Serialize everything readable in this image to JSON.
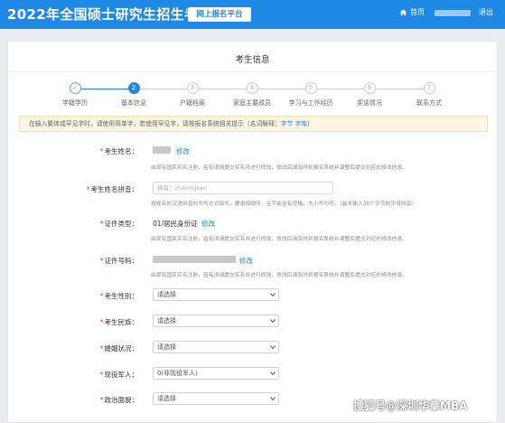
{
  "header": {
    "title": "2022年全国硕士研究生招生考试",
    "badge": "网上报名平台",
    "home_label": "首页",
    "logout_label": "退出",
    "bg_color": "#1e88e5"
  },
  "page_title": "考生信息",
  "steps": [
    {
      "num": "✓",
      "label": "学籍学历",
      "state": "done"
    },
    {
      "num": "2",
      "label": "基本信息",
      "state": "current"
    },
    {
      "num": "3",
      "label": "户籍档案",
      "state": "todo"
    },
    {
      "num": "4",
      "label": "家庭主要成员",
      "state": "todo"
    },
    {
      "num": "5",
      "label": "学习与工作经历",
      "state": "todo"
    },
    {
      "num": "6",
      "label": "奖惩情况",
      "state": "todo"
    },
    {
      "num": "7",
      "label": "联系方式",
      "state": "todo"
    }
  ],
  "notice": {
    "text": "在输入繁体或罕见字时，请使用简单字，若使用罕见字，请按报名系统相关提示（名词解释：",
    "link1": "字节",
    "link2": "字库",
    "end": "）"
  },
  "form": {
    "name": {
      "label": "考生姓名：",
      "edit": "修改",
      "help": "由现有国民实名注册，若有误请提交实名并进行修改，修改后请及时到报名系统并调整后提交对应的修改信息。"
    },
    "pinyin": {
      "label": "考生姓名拼音：",
      "placeholder": "拼音：zhanngsan",
      "help": "按姓名的汉语拼音的书写方式填写，要求按顺序，且不能含有空格，大小写均可。（最多输入30个字节的字母拼音）"
    },
    "id_type": {
      "label": "证件类型：",
      "value": "01/居民身份证",
      "edit": "修改",
      "help": "由现有国民实名注册，若有误请提交实名并进行修改，修改后请及时到报名系统并调整后提交对应的修改信息。"
    },
    "id_number": {
      "label": "证件号码：",
      "edit": "修改",
      "help": "由现有国民实名注册，若有误请提交实名并进行修改，修改后请及时到报名系统并调整后提交对应的修改信息。"
    },
    "gender": {
      "label": "考生性别：",
      "value": "请选择"
    },
    "ethnicity": {
      "label": "考生民族：",
      "value": "请选择"
    },
    "marital": {
      "label": "婚姻状况：",
      "value": "请选择"
    },
    "military": {
      "label": "现役军人：",
      "value": "0(非现役军人)"
    },
    "political": {
      "label": "政治面貌：",
      "value": "请选择"
    }
  },
  "watermark": "搜狐号@深圳华章MBA"
}
